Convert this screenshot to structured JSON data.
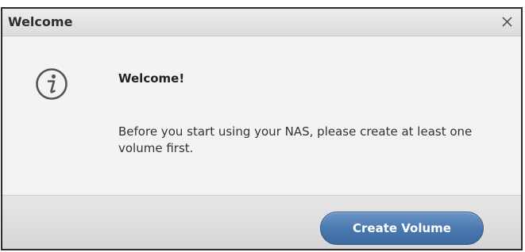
{
  "dialog": {
    "title": "Welcome",
    "close_icon": "close-icon",
    "info_icon": "info-icon",
    "heading": "Welcome!",
    "message": "Before you start using your NAS, please create at least one volume first.",
    "create_button_label": "Create Volume"
  },
  "colors": {
    "button_bg": "#4877ae",
    "title_bg": "#e4e4e4",
    "body_bg": "#f3f3f3"
  }
}
